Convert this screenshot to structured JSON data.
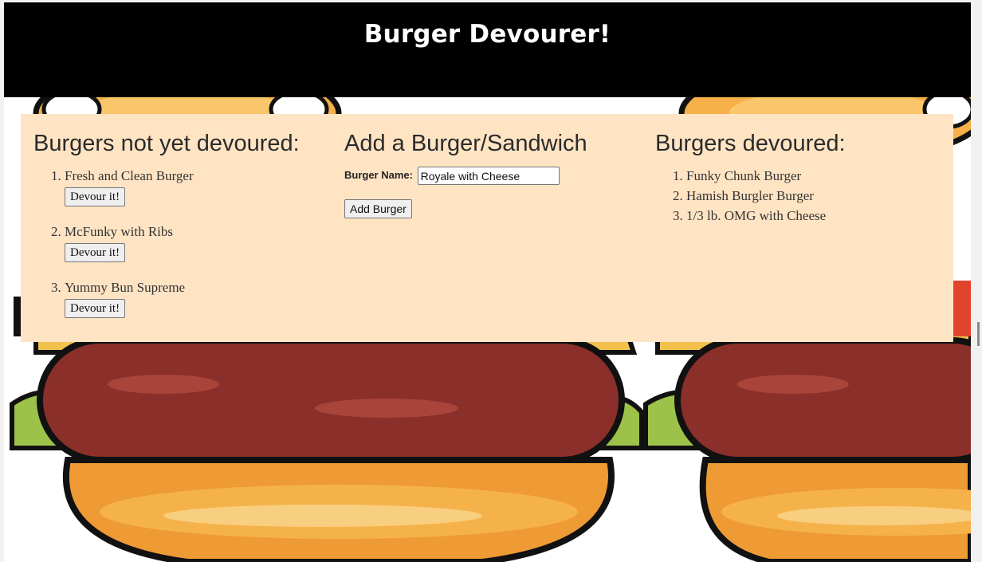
{
  "header": {
    "title": "Burger Devourer!"
  },
  "not_devoured": {
    "heading": "Burgers not yet devoured:",
    "items": [
      {
        "name": "Fresh and Clean Burger",
        "button": "Devour it!"
      },
      {
        "name": "McFunky with Ribs",
        "button": "Devour it!"
      },
      {
        "name": "Yummy Bun Supreme",
        "button": "Devour it!"
      }
    ]
  },
  "add_form": {
    "heading": "Add a Burger/Sandwich",
    "label": "Burger Name:",
    "value": "Royale with Cheese",
    "submit": "Add Burger"
  },
  "devoured": {
    "heading": "Burgers devoured:",
    "items": [
      "Funky Chunk Burger",
      "Hamish Burgler Burger",
      "1/3 lb. OMG with Cheese"
    ]
  },
  "colors": {
    "header_bg": "#000000",
    "panel_bg": "#ffe4c4",
    "patty": "#8b2f2a",
    "lettuce": "#9cc24a",
    "bun": "#f0a43a"
  }
}
